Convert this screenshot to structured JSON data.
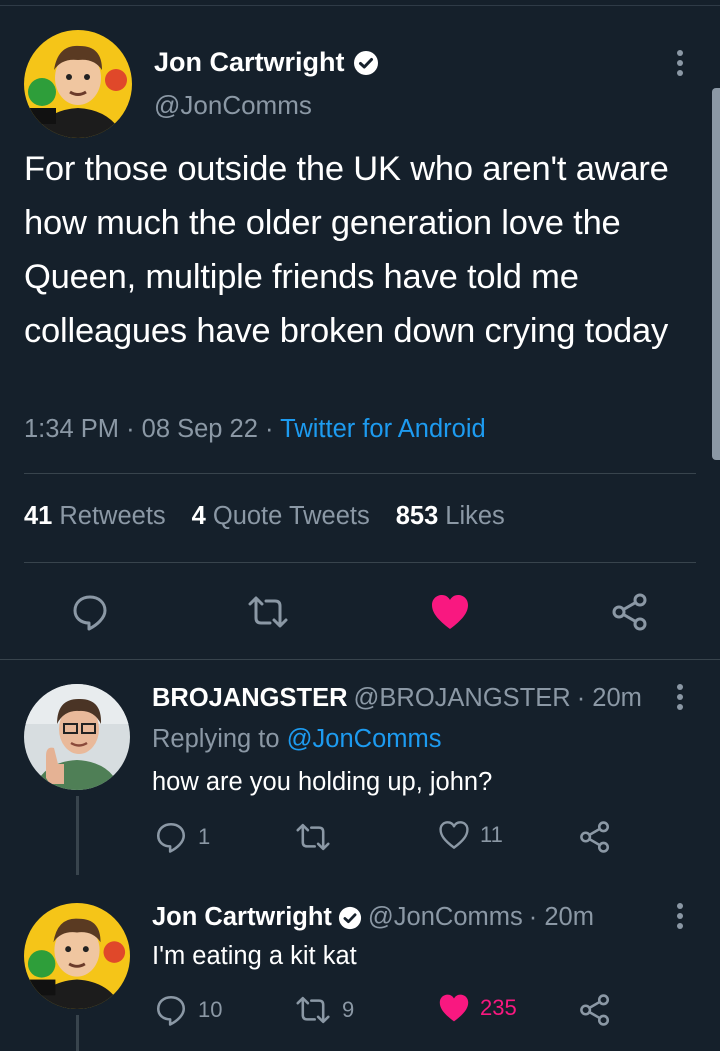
{
  "main_tweet": {
    "author_name": "Jon Cartwright",
    "verified": true,
    "handle": "@JonComms",
    "text": "For those outside the UK who aren't aware how much the older generation love the Queen, multiple friends have told me colleagues have broken down crying today",
    "time": "1:34 PM",
    "date": "08 Sep 22",
    "dot": "·",
    "source": "Twitter for Android",
    "stats": {
      "retweets_count": "41",
      "retweets_label": "Retweets",
      "quotes_count": "4",
      "quotes_label": "Quote Tweets",
      "likes_count": "853",
      "likes_label": "Likes"
    },
    "liked": true
  },
  "replies": [
    {
      "name": "BROJANGSTER",
      "handle": "@BROJANGSTER",
      "time": "· 20m",
      "replying_prefix": "Replying to",
      "replying_to": "@JonComms",
      "text": "how are you holding up, john?",
      "reply_count": "1",
      "retweet_count": "",
      "like_count": "11",
      "liked": false
    },
    {
      "name": "Jon Cartwright",
      "verified": true,
      "handle": "@JonComms",
      "time": "· 20m",
      "text": "I'm eating a kit kat",
      "reply_count": "10",
      "retweet_count": "9",
      "like_count": "235",
      "liked": true
    }
  ],
  "colors": {
    "background": "#15202b",
    "secondary_text": "#8b98a5",
    "link": "#1d9bf0",
    "like": "#f91880"
  }
}
